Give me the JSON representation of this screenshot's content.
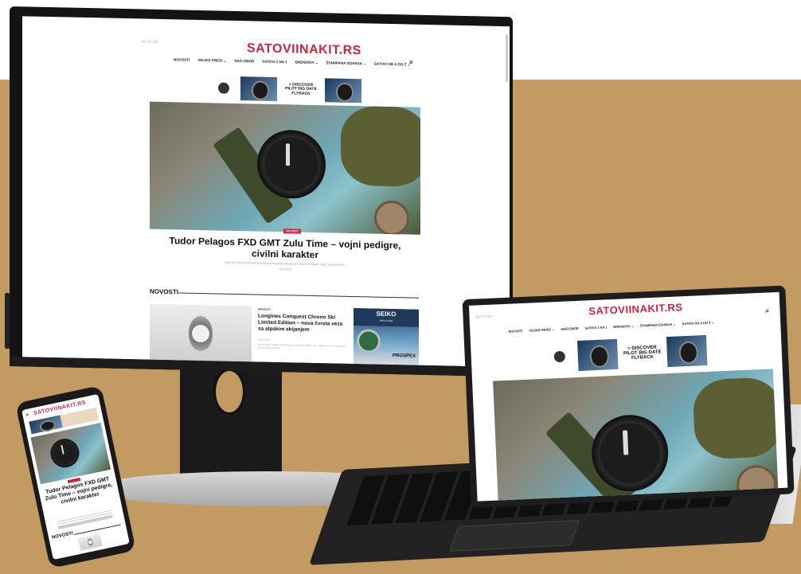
{
  "site": {
    "logo": "SATOVIINAKIT.RS",
    "date": "08 / 07 / 25",
    "nav": [
      "NOVOSTI",
      "VELIKE PRIČE ⌄",
      "NAŠ IZBOR",
      "SATOVI 1 NA 1",
      "BRENDOVI ⌄",
      "ŠTAMPANA IZDANJA ⌄",
      "SATOVI OD A DO Ž ⌄"
    ],
    "search_icon": "search-icon"
  },
  "ad": {
    "line1": "> DISCOVER",
    "line2": "PILOT BIG DATE",
    "line3": "FLYBACK"
  },
  "hero": {
    "category": "NOVOSTI",
    "title": "Tudor Pelagos FXD GMT Zulu Time – vojni pedigre, civilni karakter",
    "excerpt": "Tudor se ovaka kombinuje promoviju novog sata popularne kolekcije Pelagos, ipak, ovom prilikom...",
    "author": "Sa Srebro"
  },
  "news_section": {
    "title": "NOVOSTI",
    "card": {
      "tag": "NOVOSTI",
      "title": "Longines Conquest Chrono Ski Limited Edition – nova čvrsta veza sa alpskim skijanjem",
      "meta": "08.07.2025",
      "body": "Još od 1924. godine Longines je zvanični tajmkiper, pa i skijanju ovo nisu ostavljeni ravnodušne ljubitelje."
    }
  },
  "side_ad": {
    "brand": "SEIKO",
    "since": "SINCE 1881",
    "line": "PROSPEX"
  },
  "phone": {
    "headline": "Tudor Pelagos FXD GMT Zulu Time – vojni pedigre, civilni karakter",
    "section": "NOVOSTI"
  },
  "colors": {
    "brand_red": "#d2243b",
    "background_tan": "#c49a63"
  }
}
